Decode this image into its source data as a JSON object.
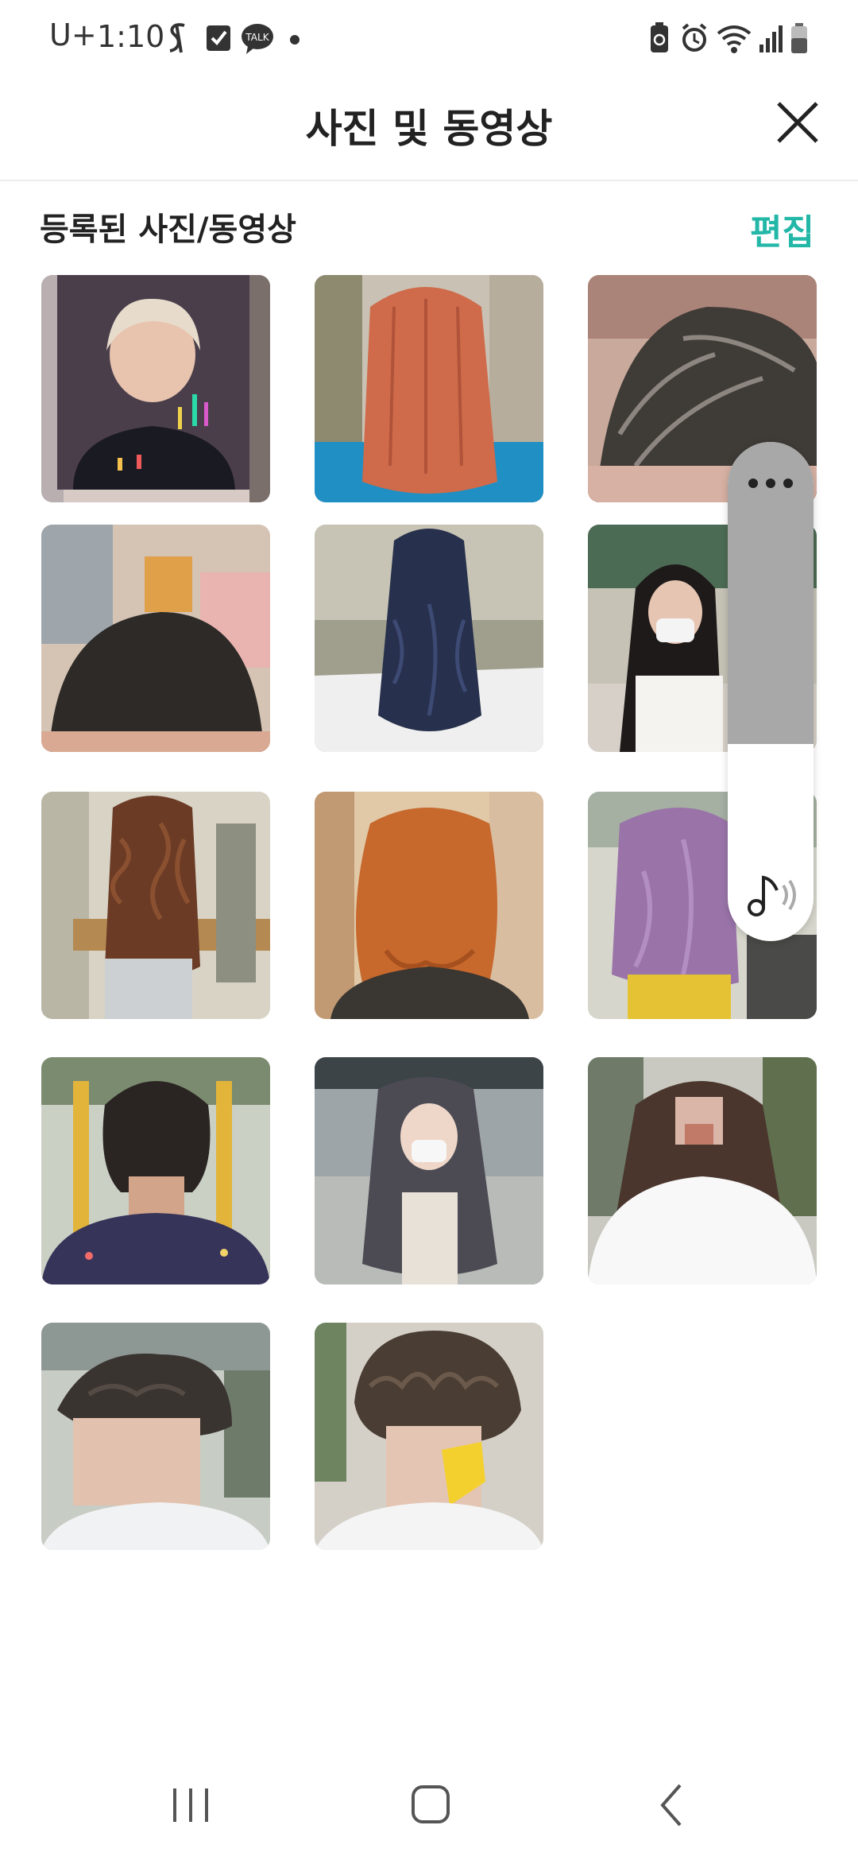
{
  "status_bar": {
    "carrier": "U+",
    "time": "1:10",
    "icons": [
      "s-logo-icon",
      "checkbox-icon",
      "kakaotalk-icon",
      "dot-icon",
      "battery-saver-icon",
      "alarm-icon",
      "wifi-icon",
      "signal-icon",
      "battery-icon"
    ],
    "talk_label": "TALK"
  },
  "header": {
    "title": "사진 및 동영상",
    "close_icon": "close-icon"
  },
  "section": {
    "title": "등록된 사진/동영상",
    "edit_label": "편집",
    "accent_color": "#23b7a8"
  },
  "gallery": {
    "items": [
      {
        "icon": "photo-id-portrait"
      },
      {
        "icon": "photo-orange-hair"
      },
      {
        "icon": "photo-gray-hair"
      },
      {
        "icon": "photo-dark-short-hair"
      },
      {
        "icon": "photo-navy-wavy-hair"
      },
      {
        "icon": "photo-woman-mask"
      },
      {
        "icon": "photo-curly-perm"
      },
      {
        "icon": "photo-copper-bob"
      },
      {
        "icon": "photo-lavender-hair"
      },
      {
        "icon": "photo-short-cut"
      },
      {
        "icon": "photo-ash-long-hair"
      },
      {
        "icon": "photo-brown-wavy-hair"
      },
      {
        "icon": "photo-men-perm"
      },
      {
        "icon": "photo-men-curly"
      }
    ]
  },
  "floating_panel": {
    "more_icon": "more-horizontal-icon",
    "sound_icon": "music-note-icon"
  },
  "nav_bar": {
    "icons": [
      "recent-apps-icon",
      "home-icon",
      "back-icon"
    ]
  }
}
